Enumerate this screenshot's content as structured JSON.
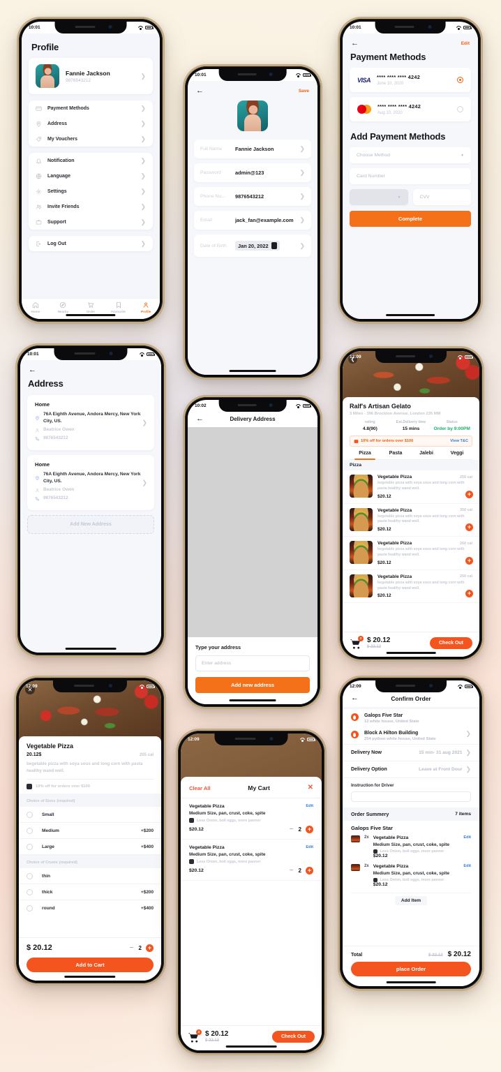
{
  "profile_screen": {
    "status_time": "10:01",
    "title": "Profile",
    "user": {
      "name": "Fannie Jackson",
      "phone": "9876543212"
    },
    "group1": [
      {
        "label": "Payment Methods",
        "icon": "credit-card-icon"
      },
      {
        "label": "Address",
        "icon": "map-pin-icon"
      },
      {
        "label": "My Vouchers",
        "icon": "tag-icon"
      }
    ],
    "group2": [
      {
        "label": "Notification",
        "icon": "bell-icon"
      },
      {
        "label": "Language",
        "icon": "globe-icon"
      },
      {
        "label": "Settings",
        "icon": "gear-icon"
      },
      {
        "label": "Invite Friends",
        "icon": "users-icon"
      },
      {
        "label": "Support",
        "icon": "briefcase-icon"
      }
    ],
    "logout": {
      "label": "Log Out",
      "icon": "logout-icon"
    },
    "tabs": [
      {
        "label": "Home",
        "icon": "home-icon",
        "active": false
      },
      {
        "label": "Nearby",
        "icon": "compass-icon",
        "active": false
      },
      {
        "label": "Order",
        "icon": "cart-icon",
        "active": false
      },
      {
        "label": "Favourite",
        "icon": "bookmark-icon",
        "active": false
      },
      {
        "label": "Profile",
        "icon": "person-icon",
        "active": true
      }
    ]
  },
  "edit_profile_screen": {
    "status_time": "10:01",
    "save_label": "Save",
    "fields": [
      {
        "label": "Full Name",
        "value": "Fannie Jackson"
      },
      {
        "label": "Password",
        "value": "admin@123"
      },
      {
        "label": "Phone Nu...",
        "value": "9876543212"
      },
      {
        "label": "Email",
        "value": "jack_fan@example.com"
      },
      {
        "label": "Date of Birth",
        "value": "Jan 20, 2022"
      }
    ]
  },
  "payment_screen": {
    "status_time": "10:01",
    "edit_label": "Edit",
    "title": "Payment Methods",
    "cards": [
      {
        "brand": "VISA",
        "number": "**** **** **** 4242",
        "date": "June 10, 2020",
        "selected": true
      },
      {
        "brand": "Mastercard",
        "number": "**** **** **** 4242",
        "date": "Aug 10, 2020",
        "selected": false
      }
    ],
    "add_title": "Add Payment Methods",
    "method_placeholder": "Choose Method",
    "card_number_placeholder": "Card Number",
    "cvv_placeholder": "CVV",
    "complete_label": "Complete"
  },
  "address_screen": {
    "status_time": "10:01",
    "title": "Address",
    "addresses": [
      {
        "label": "Home",
        "street": "76A Eighth Avenue, Andora Mercy, New York City, US.",
        "person": "Beatrice Owen",
        "phone": "9876543212"
      },
      {
        "label": "Home",
        "street": "76A Eighth Avenue, Andora Mercy, New York City, US.",
        "person": "Beatrice Owen",
        "phone": "9876543212"
      }
    ],
    "add_new_label": "Add New Address"
  },
  "delivery_address_screen": {
    "status_time": "10:02",
    "title": "Delivery Address",
    "type_label": "Type your address",
    "input_placeholder": "Enter address",
    "add_button": "Add new address"
  },
  "restaurant_screen": {
    "status_time": "12:09",
    "name": "Ralf's Artisan Gelato",
    "address": "3 Miles - 396 Brockton Avenue, London 235 MM",
    "stats": [
      {
        "label": "rating",
        "value": "4.8(90)"
      },
      {
        "label": "Est.Delivery time",
        "value": "15 mins"
      },
      {
        "label": "Status",
        "value": "Order by 9:00PM"
      }
    ],
    "promo_text": "10% off for orders over $100",
    "promo_link": "View T&C",
    "tabs": [
      "Pizza",
      "Pasta",
      "Jalebi",
      "Veggi"
    ],
    "active_tab": "Pizza",
    "section_label": "Pizza",
    "items": [
      {
        "name": "Vegetable Pizza",
        "cal": "250 cal",
        "desc": "begetable pizza with soya sous and long corn with pasta healthy wand well.",
        "price": "$20.12"
      },
      {
        "name": "Vegetable Pizza",
        "cal": "350 cal",
        "desc": "begetable pizza with soya sous and long corn with pasta healthy wand well.",
        "price": "$20.12"
      },
      {
        "name": "Vegetable Pizza",
        "cal": "260 cal",
        "desc": "begetable pizza with soya sous and long corn with pasta healthy wand well.",
        "price": "$20.12"
      },
      {
        "name": "Vegetable Pizza",
        "cal": "250 cal",
        "desc": "begetable pizza with soya sous and long corn with pasta healthy wand well.",
        "price": "$20.12"
      }
    ],
    "cart": {
      "badge": "2",
      "total": "$ 20.12",
      "old_total": "$ 22.12",
      "checkout": "Check Out"
    }
  },
  "product_screen": {
    "status_time": "12:09",
    "name": "Vegetable Pizza",
    "price": "20.12$",
    "cal": "205 cal",
    "desc": "begetable pizza with soya sous and long corn with pasta healthy wand well.",
    "promo": "10% off for orders over $100",
    "size_section": {
      "title": "Choice of Sizes",
      "required": "(required)"
    },
    "sizes": [
      {
        "name": "Small",
        "extra": ""
      },
      {
        "name": "Medium",
        "extra": "+$200"
      },
      {
        "name": "Large",
        "extra": "+$400"
      }
    ],
    "crust_section": {
      "title": "Choice of Crusts",
      "required": "(required)"
    },
    "crusts": [
      {
        "name": "thin",
        "extra": ""
      },
      {
        "name": "thick",
        "extra": "+$200"
      },
      {
        "name": "round",
        "extra": "+$400"
      }
    ],
    "total": "$ 20.12",
    "quantity": "2",
    "add_to_cart": "Add to Cart"
  },
  "cart_screen": {
    "status_time": "12:09",
    "clear_all": "Clear All",
    "title": "My Cart",
    "items": [
      {
        "name": "Vegetable Pizza",
        "options": "Medium Size, pan, crust, coke, spite",
        "note": "Less Onion, boil eggs, more panner",
        "price": "$20.12",
        "qty": "2",
        "edit": "Edit"
      },
      {
        "name": "Vegetable Pizza",
        "options": "Medium Size, pan, crust, coke, spite",
        "note": "Less Onion, boil eggs, more panner",
        "price": "$20.12",
        "qty": "2",
        "edit": "Edit"
      }
    ],
    "cart": {
      "badge": "2",
      "total": "$ 20.12",
      "old_total": "$ 22.12",
      "checkout": "Check Out"
    }
  },
  "confirm_screen": {
    "status_time": "12:09",
    "title": "Confirm Order",
    "locations": [
      {
        "name": "Galops Five Star",
        "sub": "12 white house, United State"
      },
      {
        "name": "Block A Hilton Building",
        "sub": "254 python white house, United State"
      }
    ],
    "delivery_now": {
      "key": "Delivery Now",
      "value": "15 min- 31 aug 2021"
    },
    "delivery_option": {
      "key": "Delivery Option",
      "value": "Leave at Front Dour"
    },
    "instruction_label": "Instruction for Driver",
    "order_summary": {
      "label": "Order Summery",
      "count": "7 items"
    },
    "store_name": "Galops Five Star",
    "items": [
      {
        "qty": "2x",
        "name": "Vegetable Pizza",
        "options": "Medium Size, pan, crust, coke, spite",
        "note": "Less Onion, boil eggs, more panner",
        "price": "$20.12",
        "edit": "Edit"
      },
      {
        "qty": "2x",
        "name": "Vegetable Pizza",
        "options": "Medium Size, pan, crust, coke, spite",
        "note": "Less Onion, boil eggs, more panner",
        "price": "$20.12",
        "edit": "Edit"
      }
    ],
    "add_item": "Add Item",
    "total": {
      "key": "Total",
      "old": "$ 22.12",
      "value": "$ 20.12"
    },
    "place_order": "place Order"
  }
}
